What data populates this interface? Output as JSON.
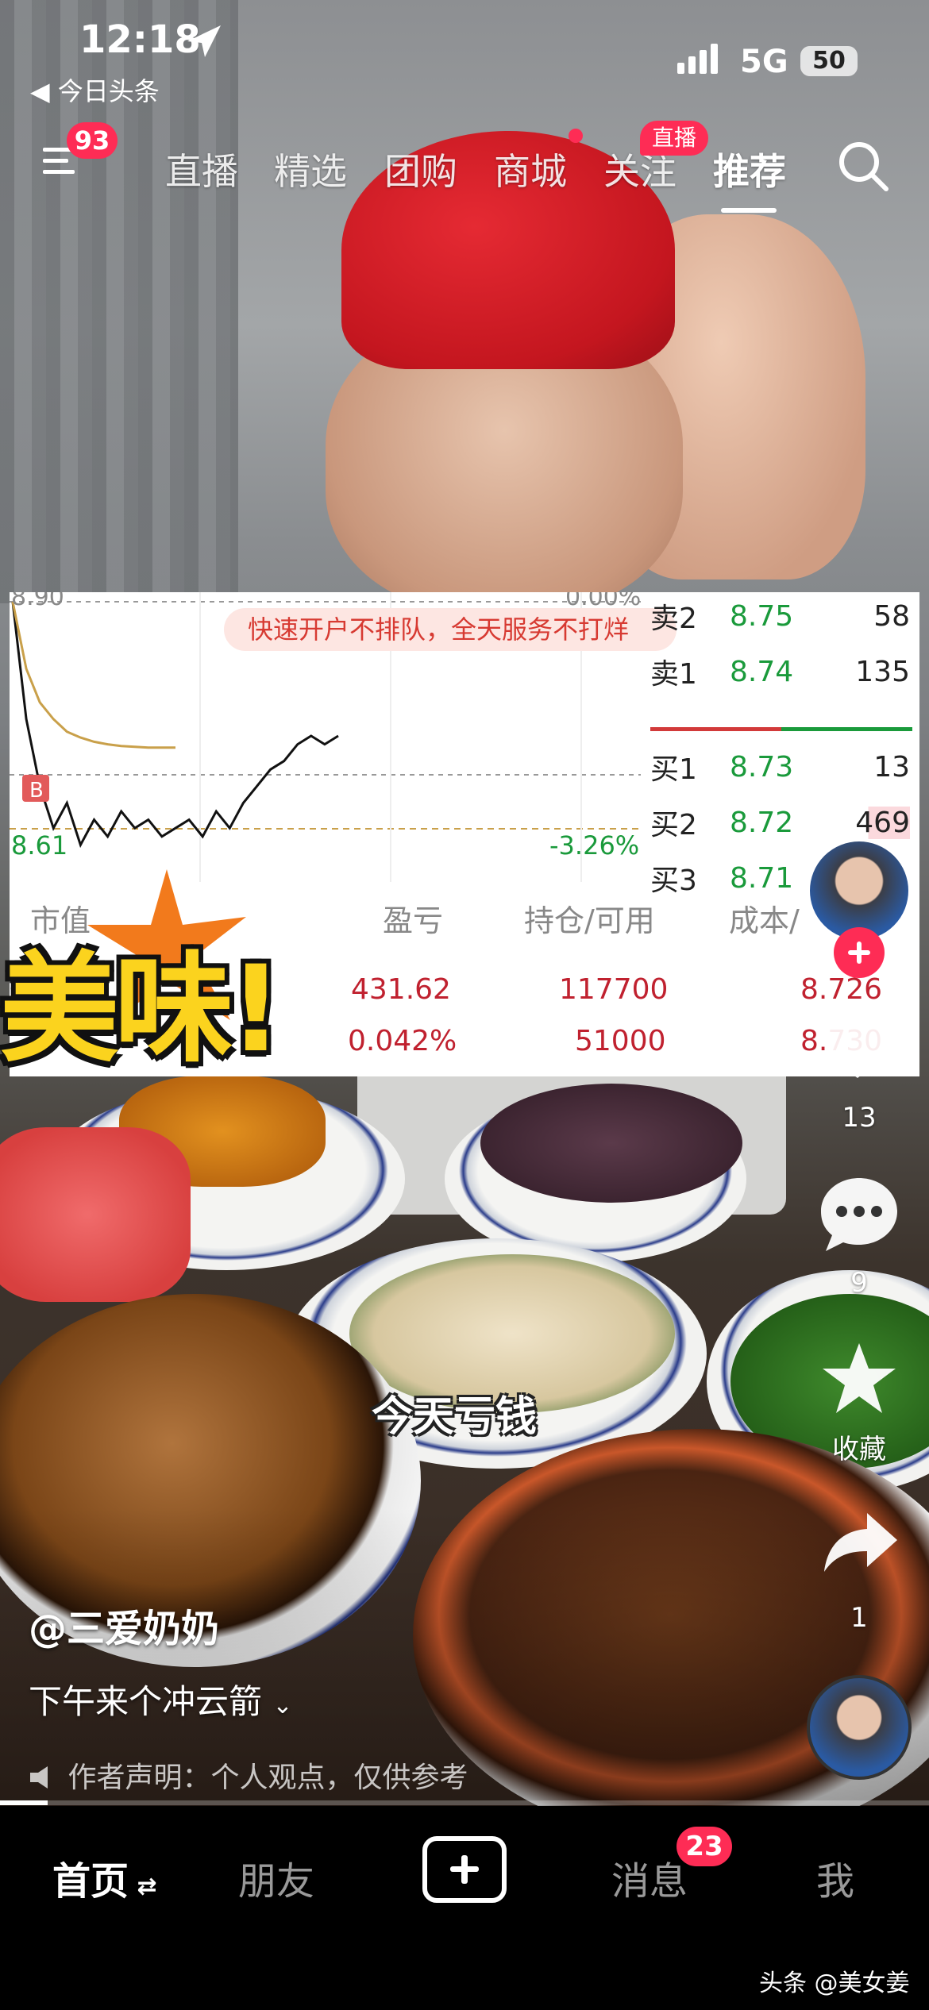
{
  "status_bar": {
    "time": "12:18",
    "back_app": "今日头条",
    "network": "5G",
    "battery": "50"
  },
  "top_nav": {
    "menu_badge": "93",
    "tabs": [
      "直播",
      "精选",
      "团购",
      "商城",
      "关注",
      "推荐"
    ],
    "active_tab": "推荐",
    "follow_live_badge": "直播"
  },
  "stock_overlay": {
    "banner": "快速开户不排队，全天服务不打烊",
    "chart_labels": {
      "top_left": "8.90",
      "top_right": "0.00%",
      "low_left": "8.61",
      "low_right": "-3.26%",
      "marker": "B"
    },
    "order_book": [
      {
        "label": "卖2",
        "price": "8.75",
        "volume": "58"
      },
      {
        "label": "卖1",
        "price": "8.74",
        "volume": "135"
      },
      {
        "label": "买1",
        "price": "8.73",
        "volume": "13"
      },
      {
        "label": "买2",
        "price": "8.72",
        "volume": "469"
      },
      {
        "label": "买3",
        "price": "8.71",
        "volume": ""
      }
    ],
    "positions_header": [
      "市值",
      "盈亏",
      "持仓/可用",
      "成本/"
    ],
    "positions_rows": [
      [
        "",
        "431.62",
        "117700",
        "8.726"
      ],
      [
        "",
        "0.042%",
        "51000",
        "8.730"
      ]
    ]
  },
  "chart_data": {
    "type": "line",
    "title": "",
    "xlabel": "",
    "ylabel": "",
    "ylim": [
      8.58,
      8.9
    ],
    "series": [
      {
        "values": [
          8.9,
          8.76,
          8.68,
          8.63,
          8.66,
          8.61,
          8.64,
          8.62,
          8.65,
          8.63,
          8.64,
          8.62,
          8.63,
          8.64,
          8.62,
          8.65,
          8.63,
          8.66,
          8.68,
          8.7,
          8.71,
          8.73,
          8.74,
          8.73,
          8.74
        ]
      },
      {
        "values": [
          8.9,
          8.82,
          8.78,
          8.76,
          8.745,
          8.738,
          8.733,
          8.73,
          8.728,
          8.727,
          8.726,
          8.726,
          8.726
        ]
      }
    ],
    "colors": {
      "price": "#111111",
      "average": "#c9a04a"
    }
  },
  "sticker_text": "美味!",
  "subtitle": "今天亏钱",
  "author": "@三爱奶奶",
  "description": "下午来个冲云箭",
  "disclaimer": "作者声明：个人观点，仅供参考",
  "right_rail": {
    "like_count": "13",
    "comment_count": "9",
    "favorite_label": "收藏",
    "share_count": "1"
  },
  "bottom_nav": {
    "home": "首页",
    "friends": "朋友",
    "messages": "消息",
    "messages_badge": "23",
    "me": "我"
  },
  "watermark": "头条 @美女姜"
}
